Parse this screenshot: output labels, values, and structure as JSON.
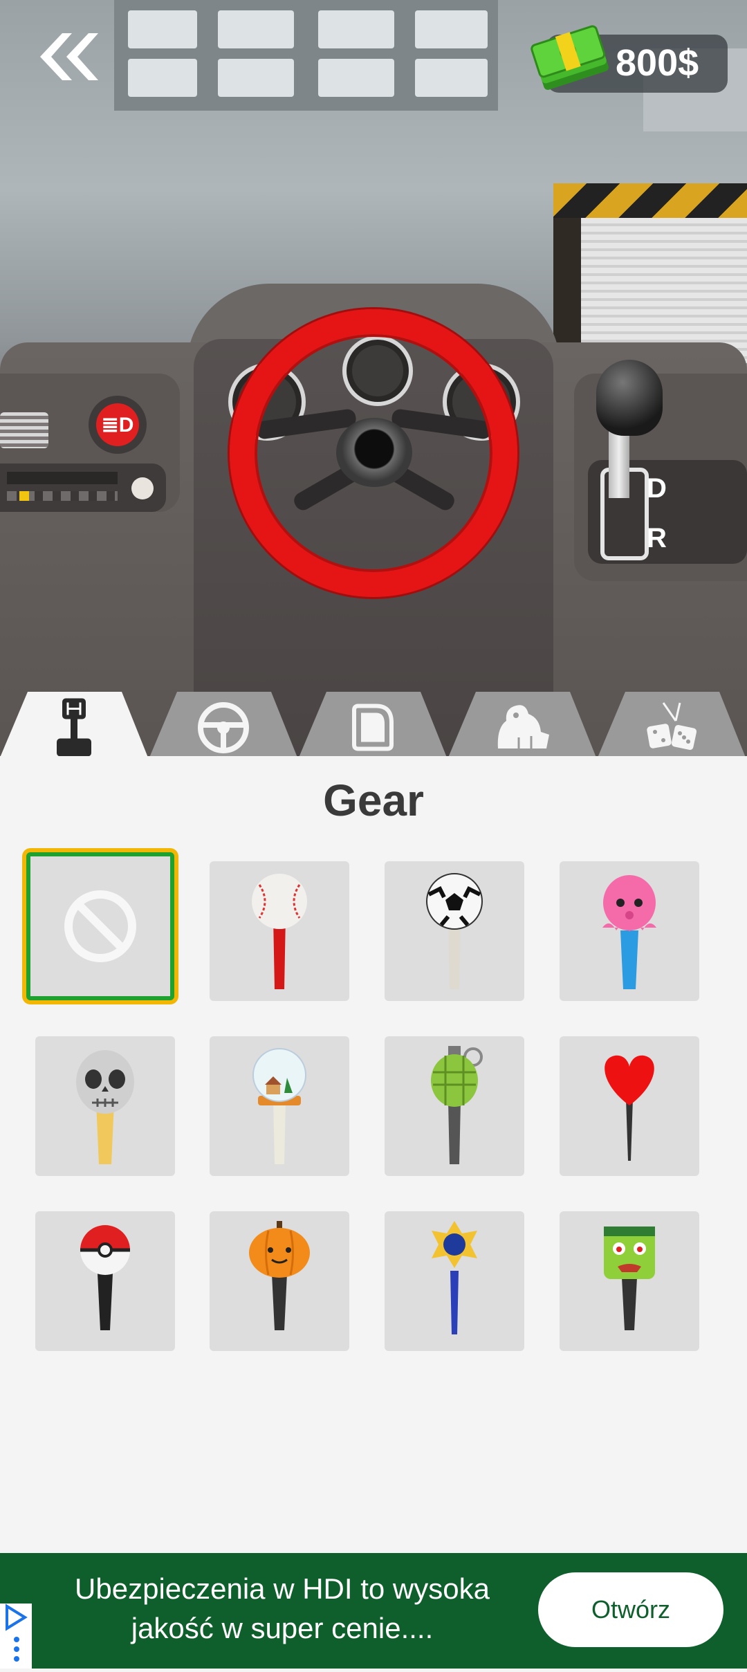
{
  "top_bar": {
    "back_icon": "double-chevron-left-icon",
    "money_icon": "cash-stack-icon",
    "money_amount": "800$"
  },
  "scene": {
    "gear_shifter_labels": [
      "D",
      "R"
    ],
    "steering_wheel_color": "#e51515"
  },
  "tabs": [
    {
      "id": "gear",
      "icon": "gear-shifter-icon",
      "active": true
    },
    {
      "id": "steering-wheel",
      "icon": "steering-wheel-icon",
      "active": false
    },
    {
      "id": "seat",
      "icon": "seat-icon",
      "active": false
    },
    {
      "id": "hood-ornament",
      "icon": "lion-icon",
      "active": false
    },
    {
      "id": "hanging-decor",
      "icon": "dice-icon",
      "active": false
    }
  ],
  "panel": {
    "title": "Gear",
    "items": [
      {
        "icon": "none-icon",
        "selected": true
      },
      {
        "icon": "baseball-knob-icon",
        "selected": false
      },
      {
        "icon": "soccer-ball-knob-icon",
        "selected": false
      },
      {
        "icon": "octopus-knob-icon",
        "selected": false
      },
      {
        "icon": "skull-knob-icon",
        "selected": false
      },
      {
        "icon": "snow-globe-knob-icon",
        "selected": false
      },
      {
        "icon": "grenade-knob-icon",
        "selected": false
      },
      {
        "icon": "heart-knob-icon",
        "selected": false
      },
      {
        "icon": "pokeball-knob-icon",
        "selected": false
      },
      {
        "icon": "pumpkin-knob-icon",
        "selected": false
      },
      {
        "icon": "scepter-knob-icon",
        "selected": false
      },
      {
        "icon": "zombie-knob-icon",
        "selected": false
      }
    ]
  },
  "ad": {
    "text_line1": "Ubezpieczenia w HDI to wysoka",
    "text_line2": "jakość w super cenie....",
    "button_label": "Otwórz",
    "background_color": "#0f5f2d"
  }
}
